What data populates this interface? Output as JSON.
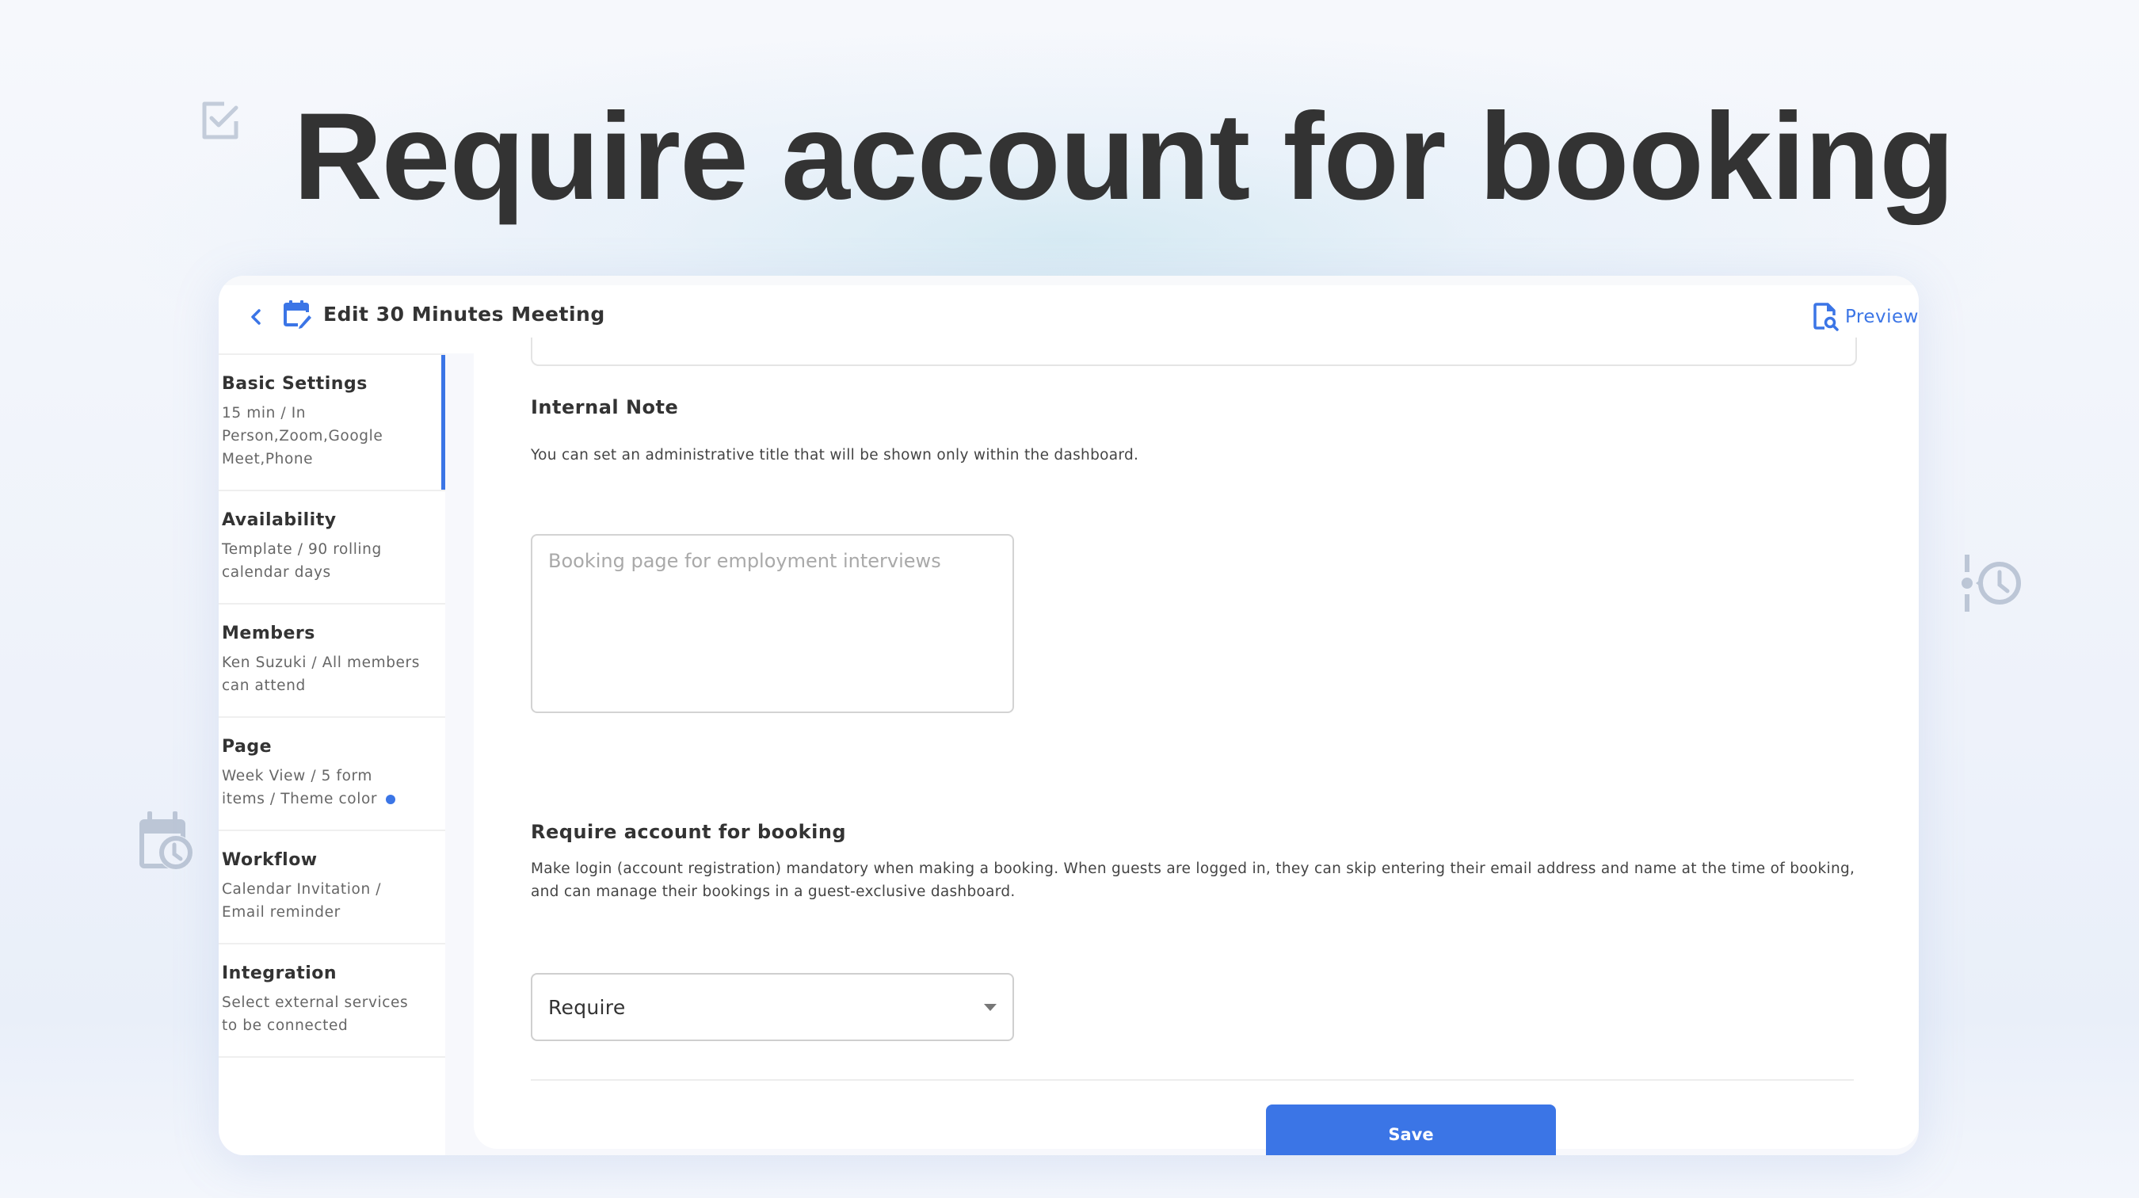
{
  "hero": {
    "title": "Require account for booking"
  },
  "decorations": [
    "checkbox-icon",
    "calendar-clock-icon",
    "timeline-clock-icon"
  ],
  "header": {
    "back_icon": "chevron-left-icon",
    "title_icon": "calendar-edit-icon",
    "title": "Edit 30 Minutes Meeting",
    "preview_icon": "file-search-icon",
    "preview_label": "Preview"
  },
  "sidebar": {
    "items": [
      {
        "title": "Basic Settings",
        "desc": "15 min / In Person,Zoom,Google Meet,Phone",
        "active": true
      },
      {
        "title": "Availability",
        "desc": "Template / 90 rolling calendar days",
        "active": false
      },
      {
        "title": "Members",
        "desc": "Ken Suzuki / All members can attend",
        "active": false
      },
      {
        "title": "Page",
        "desc": "Week View / 5 form items / Theme color",
        "active": false,
        "theme_color": "#3b75e6"
      },
      {
        "title": "Workflow",
        "desc": "Calendar Invitation / Email reminder",
        "active": false
      },
      {
        "title": "Integration",
        "desc": "Select external services to be connected",
        "active": false
      }
    ]
  },
  "main": {
    "internal_note": {
      "title": "Internal Note",
      "description": "You can set an administrative title that will be shown only within the dashboard.",
      "value": "",
      "placeholder": "Booking page for employment interviews"
    },
    "require_account": {
      "title": "Require account for booking",
      "description": "Make login (account registration) mandatory when making a booking. When guests are logged in, they can skip entering their email address and name at the time of booking, and can manage their bookings in a guest-exclusive dashboard.",
      "selected": "Require"
    },
    "save_label": "Save"
  },
  "colors": {
    "accent": "#3b75e6",
    "text": "#333333",
    "icon_muted": "#bcc6d6"
  }
}
